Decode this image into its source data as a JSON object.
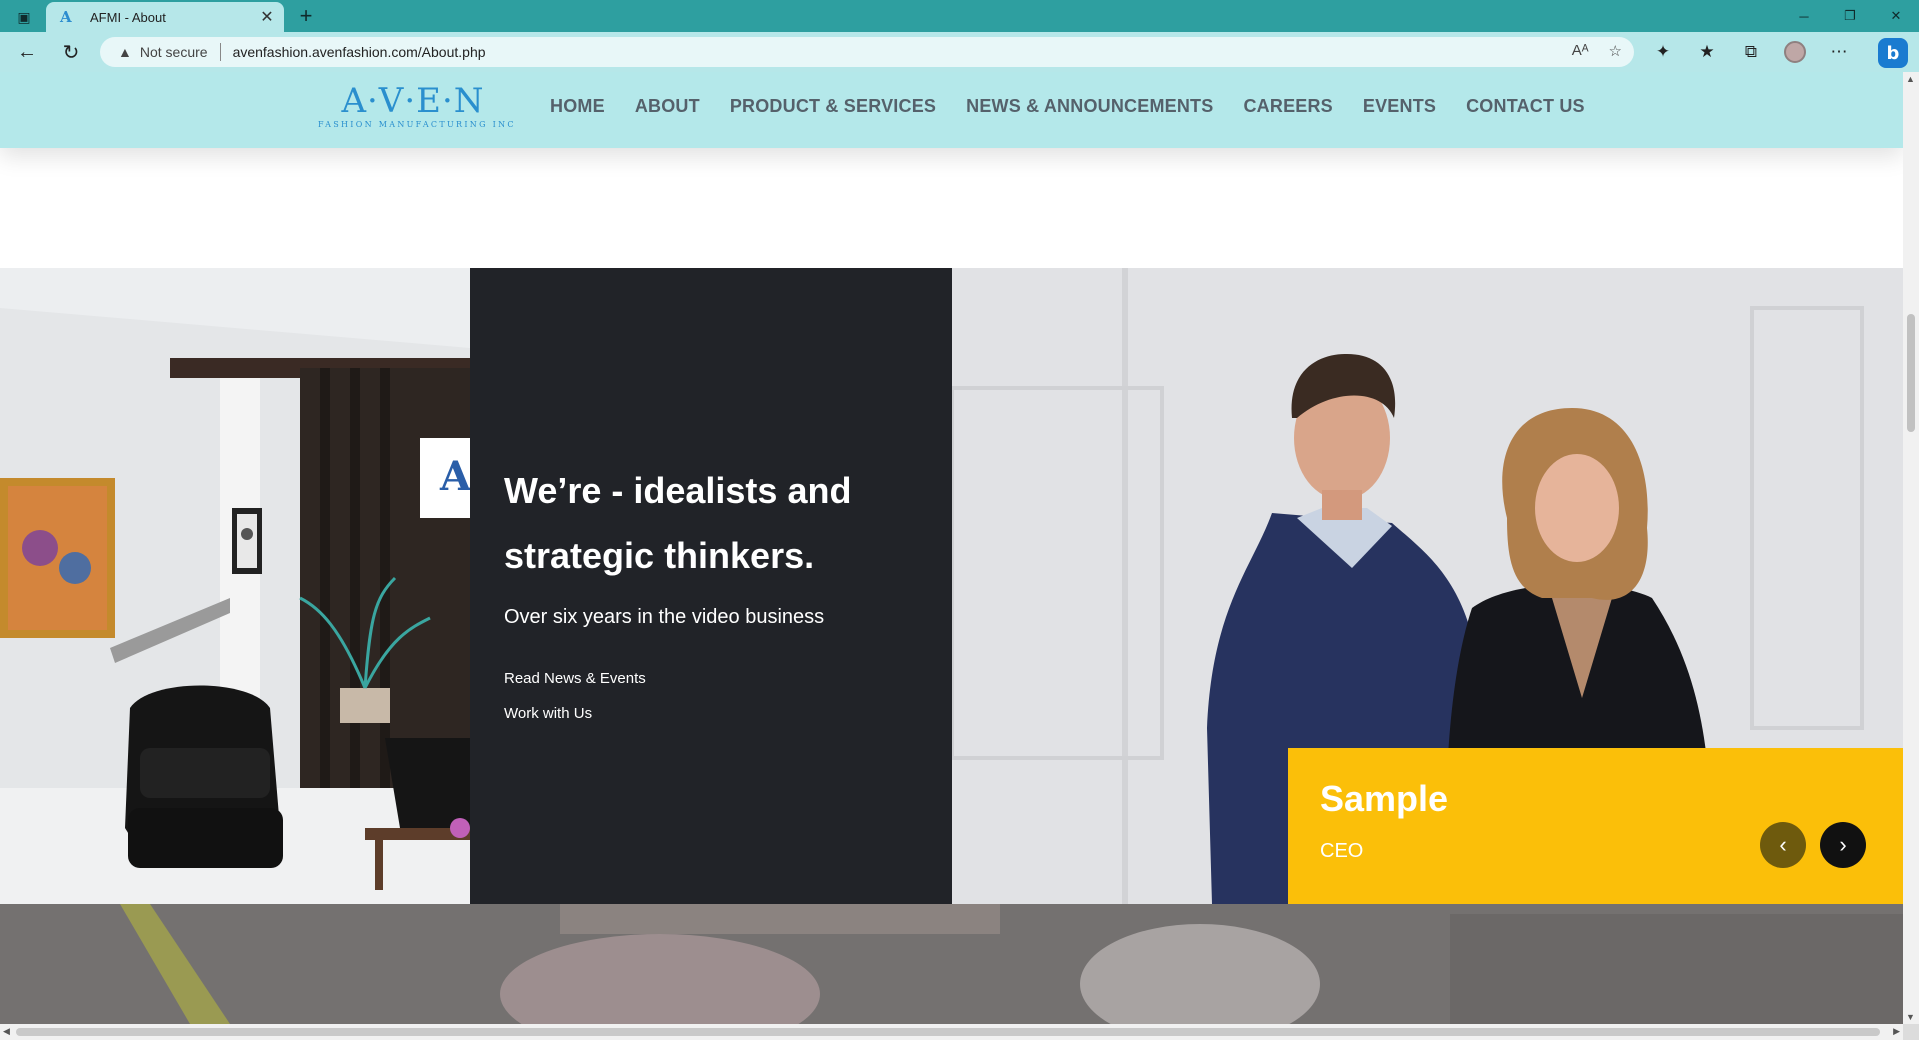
{
  "browser": {
    "tab_title": "AFMI - About",
    "address_warning": "Not secure",
    "url": "avenfashion.avenfashion.com/About.php"
  },
  "site": {
    "logo_main": "A·V·E·N",
    "logo_sub": "FASHION MANUFACTURING INC",
    "nav": [
      "HOME",
      "ABOUT",
      "PRODUCT & SERVICES",
      "NEWS & ANNOUNCEMENTS",
      "CAREERS",
      "EVENTS",
      "CONTACT US"
    ]
  },
  "hero": {
    "heading": "We’re - idealists and strategic thinkers.",
    "subheading": "Over six years in the video business",
    "links": [
      "Read News & Events",
      "Work with Us"
    ]
  },
  "team_card": {
    "name": "Sample",
    "role": "CEO"
  },
  "colors": {
    "browser_chrome": "#2e9fa0",
    "site_header": "#b4e8ea",
    "dark_panel": "#212328",
    "caption_yellow": "#fbbf09",
    "nav_text": "#55616b"
  }
}
